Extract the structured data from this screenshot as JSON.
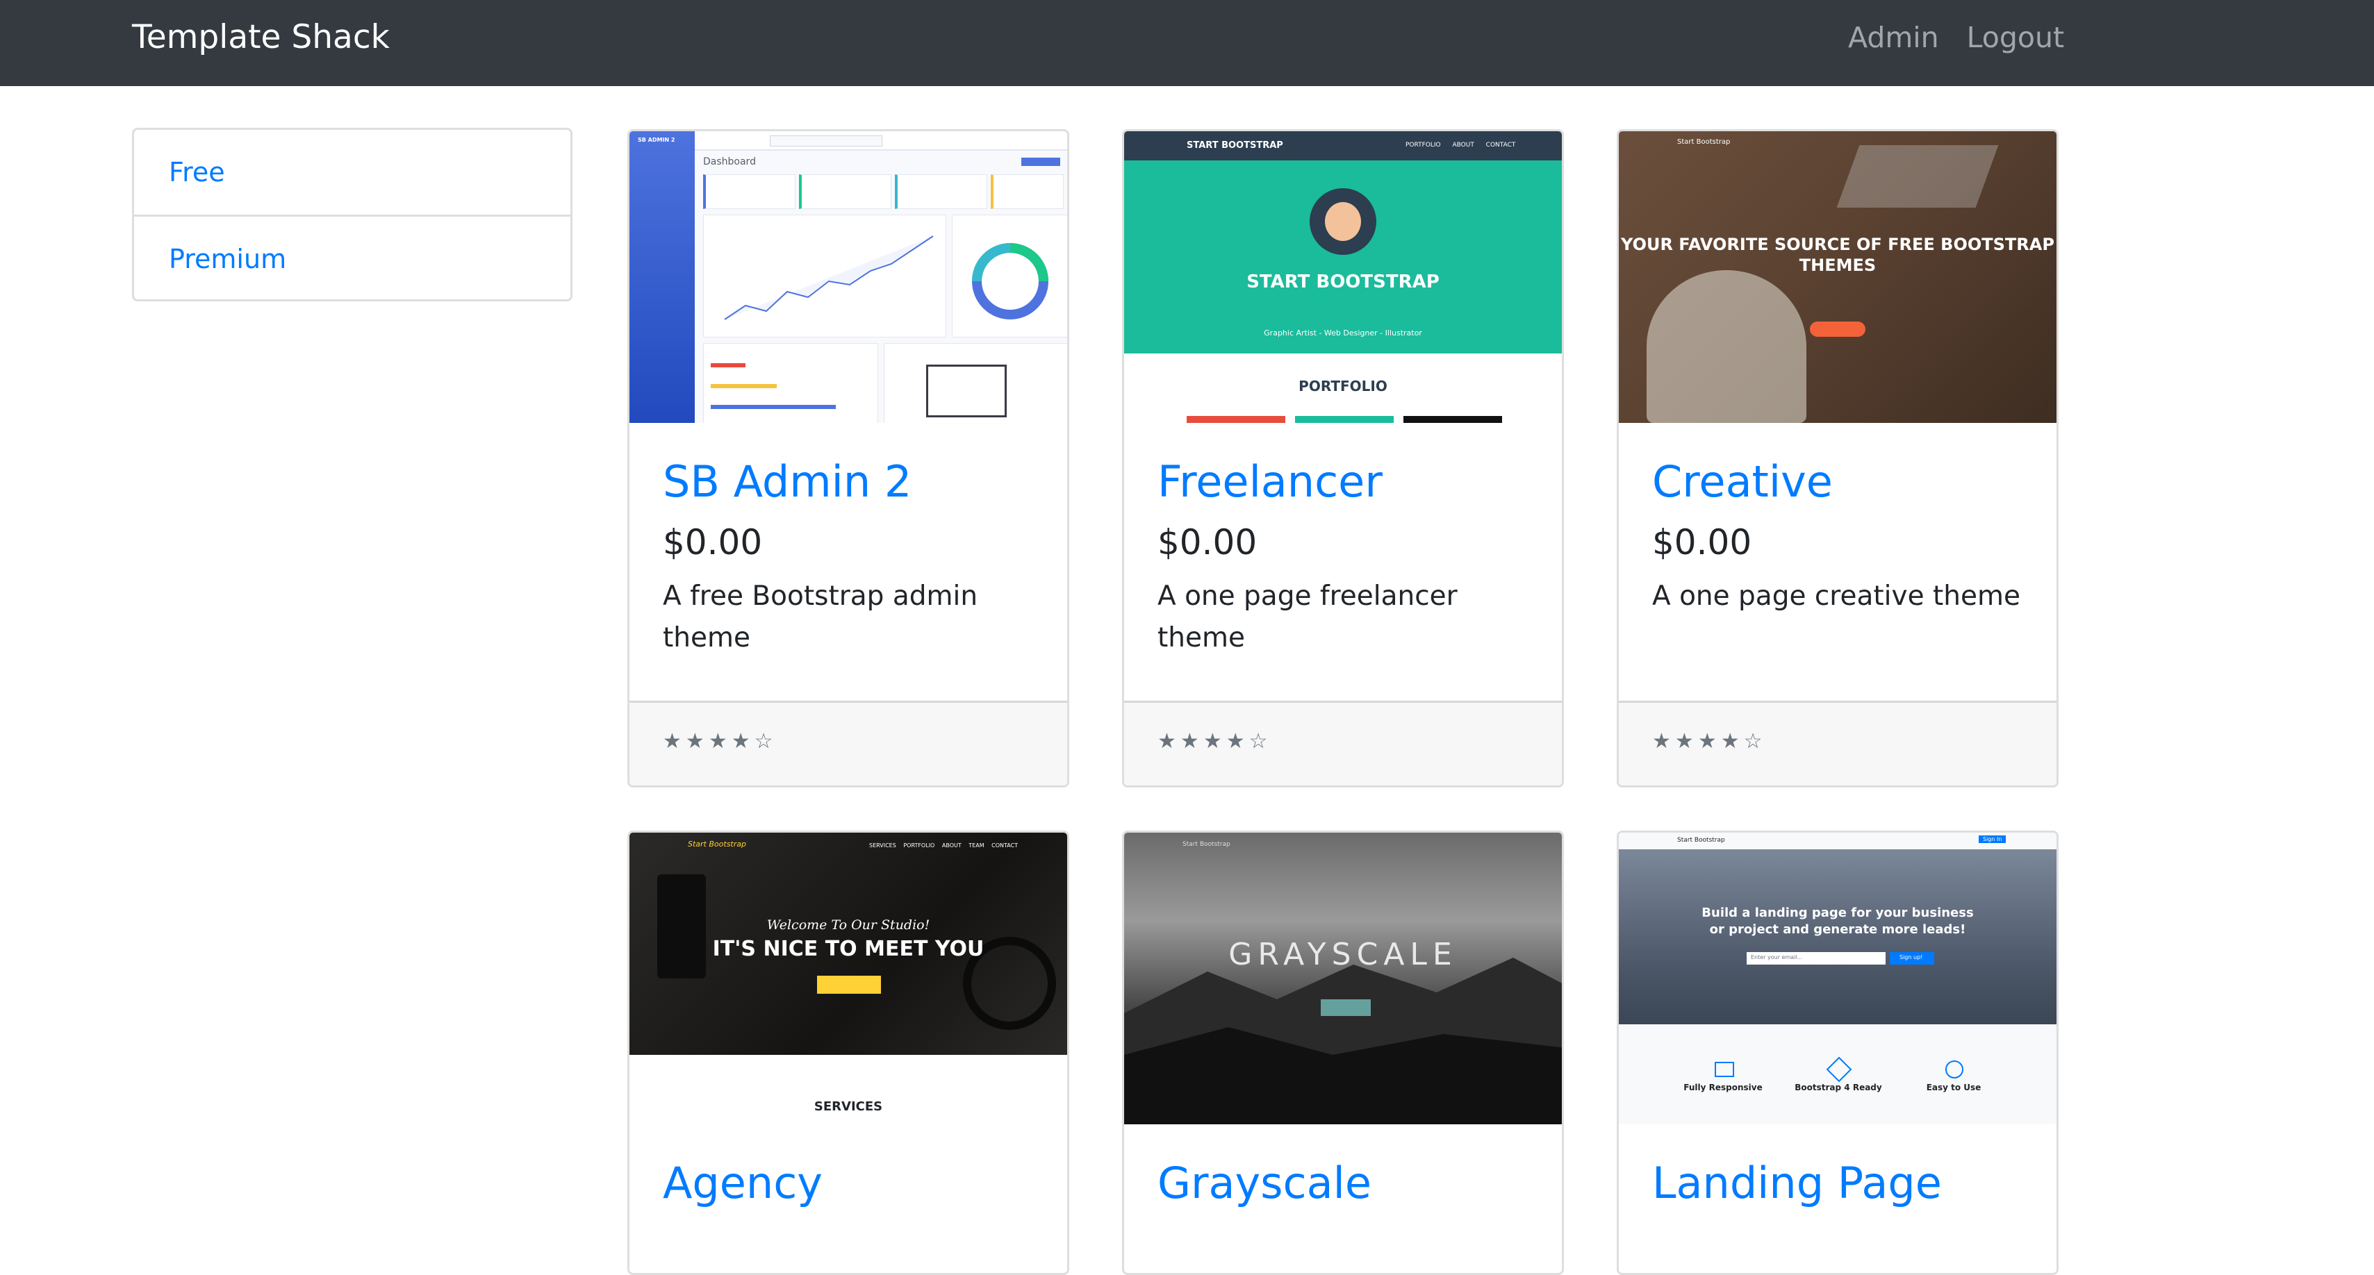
{
  "navbar": {
    "brand": "Template Shack",
    "links": [
      "Admin",
      "Logout"
    ]
  },
  "sidebar": {
    "items": [
      "Free",
      "Premium"
    ]
  },
  "cards": [
    {
      "title": "SB Admin 2",
      "price": "$0.00",
      "description": "A free Bootstrap admin theme",
      "rating": {
        "filled": 4,
        "total": 5
      },
      "thumbnail_text": [
        "SB ADMIN 2",
        "Dashboard"
      ]
    },
    {
      "title": "Freelancer",
      "price": "$0.00",
      "description": "A one page freelancer theme",
      "rating": {
        "filled": 4,
        "total": 5
      },
      "thumbnail_text": [
        "START BOOTSTRAP",
        "PORTFOLIO ABOUT CONTACT",
        "START BOOTSTRAP",
        "Graphic Artist - Web Designer - Illustrator",
        "PORTFOLIO"
      ]
    },
    {
      "title": "Creative",
      "price": "$0.00",
      "description": "A one page creative theme",
      "rating": {
        "filled": 4,
        "total": 5
      },
      "thumbnail_text": [
        "Start Bootstrap",
        "YOUR FAVORITE SOURCE OF FREE BOOTSTRAP THEMES"
      ]
    },
    {
      "title": "Agency",
      "thumbnail_text": [
        "Start Bootstrap",
        "SERVICES PORTFOLIO ABOUT TEAM CONTACT",
        "Welcome To Our Studio!",
        "IT'S NICE TO MEET YOU",
        "SERVICES"
      ]
    },
    {
      "title": "Grayscale",
      "thumbnail_text": [
        "Start Bootstrap",
        "GRAYSCALE"
      ]
    },
    {
      "title": "Landing Page",
      "thumbnail_text": [
        "Start Bootstrap",
        "Sign In",
        "Build a landing page for your business",
        "or project and generate more leads!",
        "Enter your email...",
        "Sign up!",
        "Fully Responsive",
        "Bootstrap 4 Ready",
        "Easy to Use"
      ]
    }
  ],
  "colors": {
    "navbar_bg": "#343a40",
    "link": "#007bff",
    "footer_bg": "#f7f7f7",
    "star": "#6c757d"
  }
}
